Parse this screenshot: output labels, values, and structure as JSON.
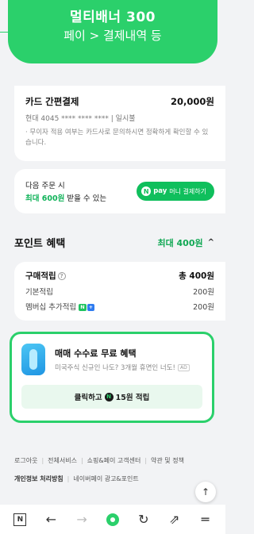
{
  "banner": {
    "line1": "멀티배너 300",
    "line2": "페이 > 결제내역 등"
  },
  "payment": {
    "method": "카드 간편결제",
    "amount": "20,000원",
    "card": "현대 4045 **** **** **** | 일시불",
    "note": "· 무이자 적용 여부는 카드사로 문의하시면 정확하게 확인할 수 있습니다."
  },
  "money_promo": {
    "line1": "다음 주문 시",
    "highlight": "최대 600원",
    "line2_rest": " 받을 수 있는",
    "button_n": "N",
    "button_label": "pay",
    "button_suffix": "머니 결제하기"
  },
  "points_section": {
    "title": "포인트 혜택",
    "max": "최대 400원",
    "chevron": "^"
  },
  "points": {
    "label": "구매적립",
    "info": "?",
    "total": "총 400원",
    "rows": [
      {
        "label": "기본적립",
        "value": "200원"
      },
      {
        "label": "멤버십 추가적립",
        "value": "200원",
        "badge1": "N",
        "badge2": "+"
      }
    ]
  },
  "promo": {
    "title": "매매 수수료 무료 혜택",
    "subtitle": "미국주식 신규인 나도? 3개월 휴면인 너도!",
    "ad_tag": "AD",
    "cta_prefix": "클릭하고",
    "coin": "N",
    "cta_suffix": "15원 적립"
  },
  "footer": {
    "row1": [
      "로그아웃",
      "전체서비스",
      "쇼핑&페이 고객센터",
      "약관 및 정책"
    ],
    "row2": [
      "개인정보 처리방침",
      "네이버페이 광고&포인트"
    ]
  },
  "toolbar": {
    "n_label": "N",
    "back": "←",
    "forward": "→",
    "refresh": "↻",
    "share": "⇗",
    "menu": "═"
  },
  "colors": {
    "accent": "#2bd06b",
    "green_text": "#11a854"
  }
}
